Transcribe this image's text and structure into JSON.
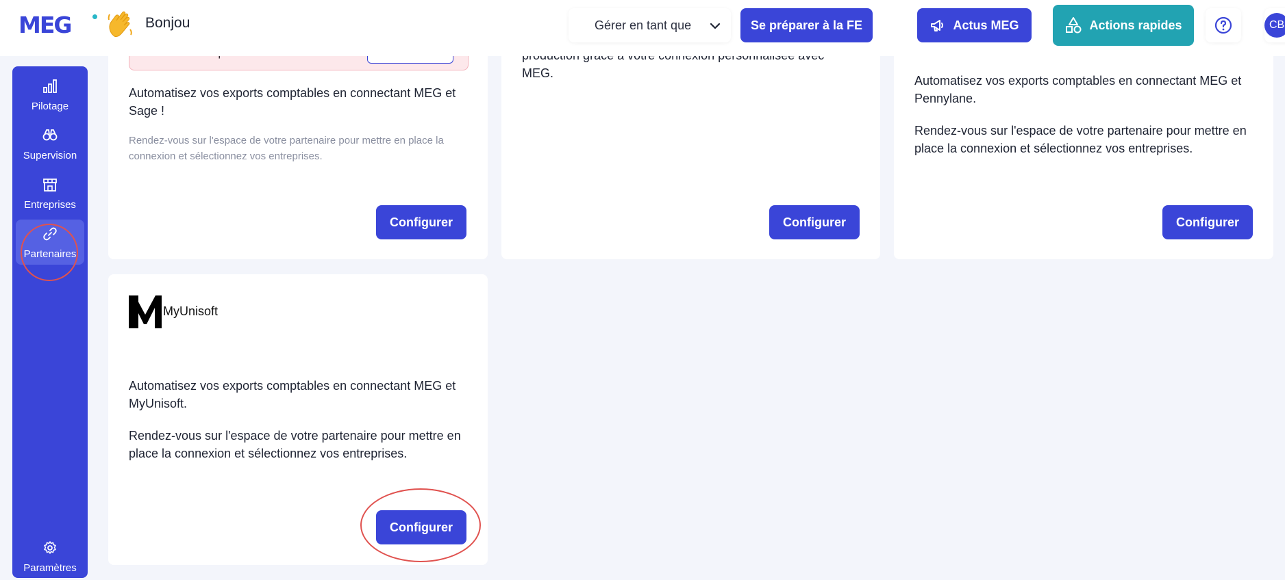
{
  "header": {
    "logo": "MEG",
    "greeting": "Bonjou",
    "manage_label": "Gérer en tant que",
    "prepare_button": "Se préparer à la FE",
    "actus_button": "Actus MEG",
    "actions_button": "Actions rapides",
    "avatar_initials": "CB"
  },
  "sidebar": {
    "items": [
      {
        "label": "Pilotage",
        "icon": "bar-chart-icon"
      },
      {
        "label": "Supervision",
        "icon": "binoculars-icon"
      },
      {
        "label": "Entreprises",
        "icon": "store-icon"
      },
      {
        "label": "Partenaires",
        "icon": "link-icon",
        "active": true
      }
    ],
    "settings_label": "Paramètres"
  },
  "cards": {
    "sage": {
      "alert_text": "os entreprises.",
      "description": "Automatisez vos exports comptables en connectant MEG et Sage !",
      "note": "Rendez-vous sur l'espace de votre partenaire pour mettre en place la connexion et sélectionnez vos entreprises.",
      "button": "Configurer"
    },
    "middle": {
      "description": "production grâce à votre connexion personnalisée avec MEG.",
      "button": "Configurer"
    },
    "pennylane": {
      "description": "Automatisez vos exports comptables en connectant MEG et Pennylane.",
      "note": "Rendez-vous sur l'espace de votre partenaire pour mettre en place la connexion et sélectionnez vos entreprises.",
      "button": "Configurer"
    },
    "myunisoft": {
      "name": "MyUnisoft",
      "description": "Automatisez vos exports comptables en connectant MEG et MyUnisoft.",
      "note": "Rendez-vous sur l'espace de votre partenaire pour mettre en place la connexion et sélectionnez vos entreprises.",
      "button": "Configurer"
    }
  },
  "colors": {
    "primary": "#3a45d8",
    "teal": "#22a3b2",
    "annotation": "#e0524f"
  }
}
